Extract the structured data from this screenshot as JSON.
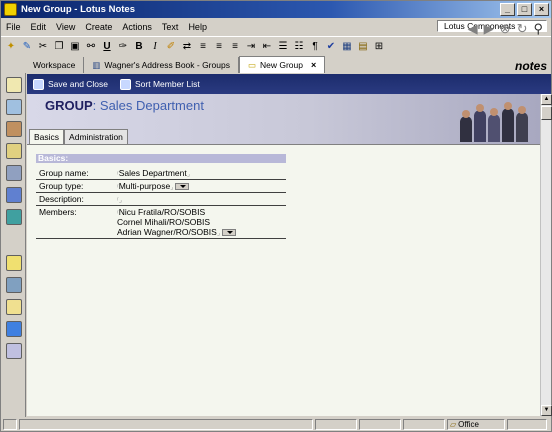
{
  "window": {
    "title": "New Group - Lotus Notes",
    "btn_min": "_",
    "btn_max": "□",
    "btn_close": "×"
  },
  "menu": [
    "File",
    "Edit",
    "View",
    "Create",
    "Actions",
    "Text",
    "Help"
  ],
  "components_label": "Lotus Components",
  "tabs": [
    {
      "label": "Workspace"
    },
    {
      "label": "Wagner's Address Book - Groups"
    },
    {
      "label": "New Group",
      "close": "×"
    }
  ],
  "brand": "notes",
  "actions": {
    "save_close": "Save and Close",
    "sort_members": "Sort Member List"
  },
  "form": {
    "heading_prefix": "GROUP",
    "heading_suffix": ": Sales Department",
    "tabs": [
      "Basics",
      "Administration"
    ],
    "section": "Basics:",
    "fields": {
      "group_name_label": "Group name:",
      "group_name_value": "Sales Department",
      "group_type_label": "Group type:",
      "group_type_value": "Multi-purpose",
      "description_label": "Description:",
      "description_value": "",
      "members_label": "Members:",
      "members": [
        "Nicu Fratila/RO/SOBIS",
        "Cornel Mihali/RO/SOBIS",
        "Adrian Wagner/RO/SOBIS"
      ]
    }
  },
  "status": {
    "location": "Office"
  }
}
